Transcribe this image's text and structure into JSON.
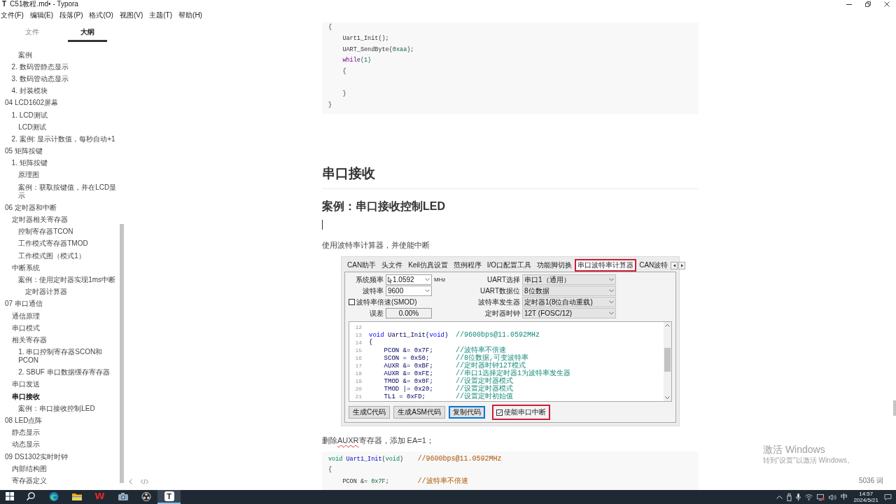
{
  "window": {
    "icon_letter": "T",
    "title": "C51教程.md• - Typora"
  },
  "menu": [
    "文件(F)",
    "编辑(E)",
    "段落(P)",
    "格式(O)",
    "视图(V)",
    "主题(T)",
    "帮助(H)"
  ],
  "sidebar": {
    "tabs": [
      {
        "label": "文件",
        "selected": false
      },
      {
        "label": "大纲",
        "selected": true
      }
    ],
    "outline": [
      {
        "children": [
          {
            "children": [
              {
                "label": "案例",
                "selected": false
              }
            ]
          },
          {
            "label": "2. 数码管静态显示",
            "selected": false
          },
          {
            "label": "3. 数码管动态显示",
            "selected": false
          },
          {
            "label": "4. 封装模块",
            "selected": false
          }
        ]
      },
      {
        "label": "04 LCD1602屏幕",
        "selected": false,
        "children": [
          {
            "label": "1. LCD测试",
            "selected": false,
            "children": [
              {
                "label": "LCD测试",
                "selected": false
              }
            ]
          },
          {
            "label": "2. 案例: 显示计数值，每秒自动+1",
            "selected": false
          }
        ]
      },
      {
        "label": "05 矩阵按键",
        "selected": false,
        "children": [
          {
            "label": "1. 矩阵按键",
            "selected": false,
            "children": [
              {
                "label": "原理图",
                "selected": false
              },
              {
                "label": "案例：获取按键值，并在LCD显示",
                "selected": false
              }
            ]
          }
        ]
      },
      {
        "label": "06 定时器和中断",
        "selected": false,
        "children": [
          {
            "label": "定时器相关寄存器",
            "selected": false,
            "children": [
              {
                "label": "控制寄存器TCON",
                "selected": false
              },
              {
                "label": "工作模式寄存器TMOD",
                "selected": false
              },
              {
                "label": "工作模式图（模式1）",
                "selected": false
              }
            ]
          },
          {
            "label": "中断系统",
            "selected": false,
            "children": [
              {
                "label": "案例：使用定时器实现1ms中断",
                "selected": false,
                "children": [
                  {
                    "label": "定时器计算器",
                    "selected": false
                  }
                ]
              }
            ]
          }
        ]
      },
      {
        "label": "07 串口通信",
        "selected": false,
        "children": [
          {
            "label": "通信原理",
            "selected": false
          },
          {
            "label": "串口模式",
            "selected": false
          },
          {
            "label": "相关寄存器",
            "selected": false,
            "children": [
              {
                "label": "1. 串口控制寄存器SCON和PCON",
                "selected": false
              },
              {
                "label": "2. SBUF 串口数据缓存寄存器",
                "selected": false
              }
            ]
          },
          {
            "label": "串口发送",
            "selected": false
          },
          {
            "label": "串口接收",
            "selected": true,
            "children": [
              {
                "label": "案例：串口接收控制LED",
                "selected": false
              }
            ]
          }
        ]
      },
      {
        "label": "08 LED点阵",
        "selected": false,
        "children": [
          {
            "label": "静态显示",
            "selected": false
          },
          {
            "label": "动态显示",
            "selected": false
          }
        ]
      },
      {
        "label": "09 DS1302实时时钟",
        "selected": false,
        "children": [
          {
            "label": "内部结构图",
            "selected": false
          },
          {
            "label": "寄存器定义",
            "selected": false
          }
        ]
      }
    ]
  },
  "document": [
    {
      "kind": "code",
      "lines": [
        {
          "kind": "text",
          "tokens": [
            {
              "kind": "plain",
              "text": "{"
            }
          ]
        },
        {
          "kind": "text",
          "tokens": [
            {
              "kind": "plain",
              "text": "    Uart1_Init();"
            }
          ]
        },
        {
          "kind": "text",
          "tokens": [
            {
              "kind": "plain",
              "text": "    UART_SendByte("
            },
            {
              "kind": "number",
              "text": "0xaa"
            },
            {
              "kind": "plain",
              "text": ");"
            }
          ]
        },
        {
          "kind": "text",
          "tokens": [
            {
              "kind": "keyword",
              "text": "    while"
            },
            {
              "kind": "number",
              "text": "(1)"
            }
          ]
        },
        {
          "kind": "text",
          "tokens": [
            {
              "kind": "plain",
              "text": "    {"
            }
          ]
        },
        {
          "kind": "blank"
        },
        {
          "kind": "text",
          "tokens": [
            {
              "kind": "plain",
              "text": "    }"
            }
          ]
        },
        {
          "kind": "text",
          "tokens": [
            {
              "kind": "plain",
              "text": "}"
            }
          ]
        }
      ]
    },
    {
      "kind": "h2",
      "text": "串口接收"
    },
    {
      "kind": "h3",
      "text": "案例：串口接收控制LED"
    },
    {
      "kind": "empty",
      "cursor": true
    },
    {
      "kind": "paragraph",
      "runs": [
        {
          "text": "使用波特率计算器，并使能中断",
          "misspelled": false
        }
      ]
    },
    {
      "kind": "screenshot",
      "tabs": [
        {
          "label": "CAN助手",
          "selected": false,
          "highlighted": false
        },
        {
          "label": "头文件",
          "selected": false,
          "highlighted": false
        },
        {
          "label": "Keil仿真设置",
          "selected": false,
          "highlighted": false
        },
        {
          "label": "范例程序",
          "selected": false,
          "highlighted": false
        },
        {
          "label": "I/O口配置工具",
          "selected": false,
          "highlighted": false
        },
        {
          "label": "功能脚切换",
          "selected": false,
          "highlighted": false
        },
        {
          "label": "串口波特率计算器",
          "selected": true,
          "highlighted": true
        },
        {
          "label": "CAN波特",
          "selected": false,
          "highlighted": false
        }
      ],
      "left_fields": [
        {
          "kind": "combo",
          "label": "系统频率",
          "value": "1.0592",
          "mouse_pointer": true,
          "unit": "MHz"
        },
        {
          "kind": "combo",
          "label": "波特率",
          "value": "9600"
        },
        {
          "kind": "checkbox",
          "label": "波特率倍速(SMOD)",
          "checked": false
        },
        {
          "kind": "readout",
          "label": "误差",
          "value": "0.00%"
        }
      ],
      "right_fields": [
        {
          "kind": "dropdown",
          "label": "UART选择",
          "value": "串口1（通用）"
        },
        {
          "kind": "dropdown",
          "label": "UART数据位",
          "value": "8位数据"
        },
        {
          "kind": "dropdown",
          "label": "波特率发生器",
          "value": "定时器1(8位自动重载)"
        },
        {
          "kind": "dropdown",
          "label": "定时器时钟",
          "value": "12T (FOSC/12)"
        }
      ],
      "editor_lines": [
        {
          "number": "12"
        },
        {
          "number": "13",
          "code": [
            {
              "kind": "keyword",
              "text": "void"
            },
            {
              "kind": "plain",
              "text": " Uart1_Init("
            },
            {
              "kind": "keyword",
              "text": "void"
            },
            {
              "kind": "plain",
              "text": ")"
            }
          ],
          "comment": "//9600bps@11.0592MHz"
        },
        {
          "number": "14",
          "code": [
            {
              "kind": "plain",
              "text": "{"
            }
          ]
        },
        {
          "number": "15",
          "code": [
            {
              "kind": "plain",
              "text": "    PCON &= 0x7F;"
            }
          ],
          "comment": "//波特率不倍速"
        },
        {
          "number": "16",
          "code": [
            {
              "kind": "plain",
              "text": "    SCON = 0x50;"
            }
          ],
          "comment": "//8位数据,可变波特率"
        },
        {
          "number": "17",
          "code": [
            {
              "kind": "plain",
              "text": "    AUXR &= 0xBF;"
            }
          ],
          "comment": "//定时器时钟12T模式"
        },
        {
          "number": "18",
          "code": [
            {
              "kind": "plain",
              "text": "    AUXR &= 0xFE;"
            }
          ],
          "comment": "//串口1选择定时器1为波特率发生器"
        },
        {
          "number": "19",
          "code": [
            {
              "kind": "plain",
              "text": "    TMOD &= 0x0F;"
            }
          ],
          "comment": "//设置定时器模式"
        },
        {
          "number": "20",
          "code": [
            {
              "kind": "plain",
              "text": "    TMOD |= 0x20;"
            }
          ],
          "comment": "//设置定时器模式"
        },
        {
          "number": "21",
          "code": [
            {
              "kind": "plain",
              "text": "    TL1 = 0xFD;"
            }
          ],
          "comment": "//设置定时初始值"
        }
      ],
      "buttons": [
        {
          "label": "生成C代码",
          "focused": false
        },
        {
          "label": "生成ASM代码",
          "focused": false
        },
        {
          "label": "复制代码",
          "focused": true
        }
      ],
      "interrupt_checkbox": {
        "label": "使能串口中断",
        "checked": true,
        "highlighted": true
      }
    },
    {
      "kind": "paragraph",
      "runs": [
        {
          "text": "删除",
          "misspelled": false
        },
        {
          "text": "AUXR",
          "misspelled": true
        },
        {
          "text": "寄存器，添加 EA=1；",
          "misspelled": false
        }
      ]
    },
    {
      "kind": "code",
      "lines": [
        {
          "kind": "text",
          "tokens": [
            {
              "kind": "type",
              "text": "void "
            },
            {
              "kind": "def",
              "text": "Uart1_Init"
            },
            {
              "kind": "plain",
              "text": "("
            },
            {
              "kind": "type",
              "text": "void"
            },
            {
              "kind": "plain",
              "text": ")    "
            },
            {
              "kind": "comment",
              "text": "//9600bps@11.0592MHz"
            }
          ]
        },
        {
          "kind": "text",
          "tokens": [
            {
              "kind": "plain",
              "text": "{"
            }
          ]
        },
        {
          "kind": "text",
          "tokens": [
            {
              "kind": "plain",
              "text": "    PCON &= "
            },
            {
              "kind": "number",
              "text": "0x7F"
            },
            {
              "kind": "plain",
              "text": ";        "
            },
            {
              "kind": "comment",
              "text": "//波特率不倍速"
            }
          ]
        }
      ]
    }
  ],
  "status": {
    "word_count": "5036 词"
  },
  "activation_notice": {
    "title": "激活 Windows",
    "hint": "转到“设置”以激活 Windows。"
  },
  "taskbar": {
    "apps": [
      {
        "kind": "start",
        "active": false
      },
      {
        "kind": "search",
        "active": false
      },
      {
        "kind": "swirl",
        "active": false
      },
      {
        "kind": "folder",
        "active": false
      },
      {
        "kind": "red-letter",
        "label": "W",
        "active": false
      },
      {
        "kind": "camera",
        "active": false
      },
      {
        "kind": "blades",
        "active": false
      },
      {
        "kind": "tile-letter",
        "label": "T",
        "active": true
      }
    ],
    "ime": "中",
    "time": "14:57",
    "date": "2024/5/21"
  }
}
